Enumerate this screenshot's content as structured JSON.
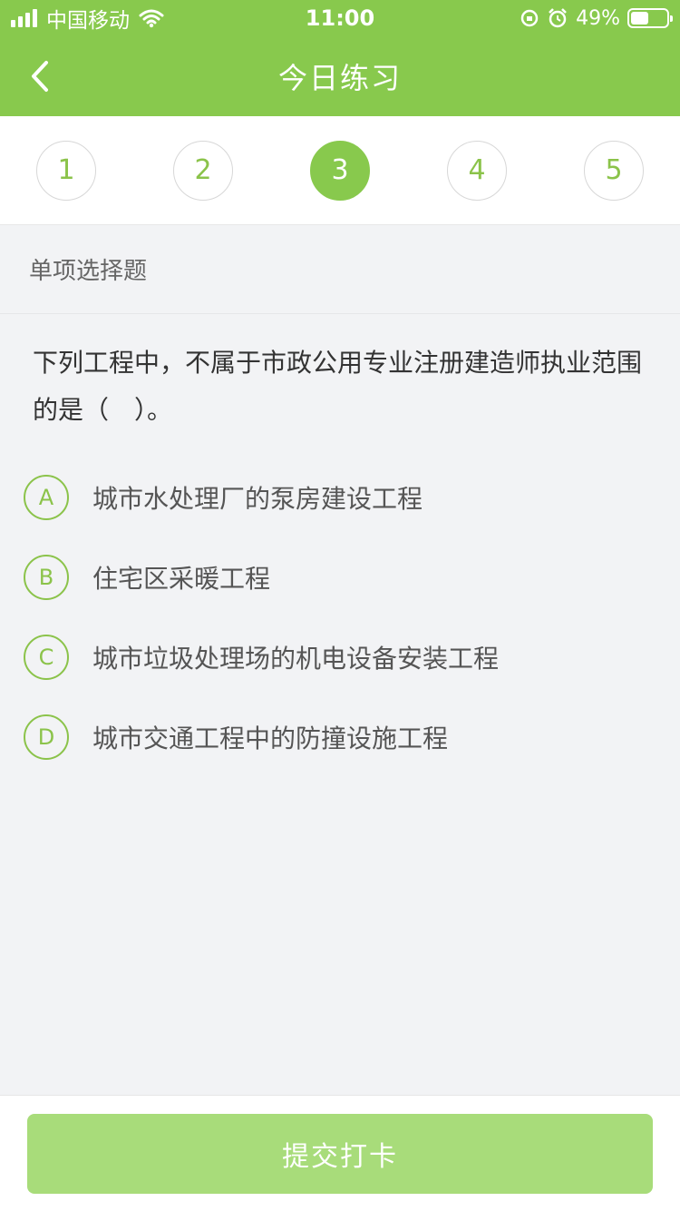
{
  "status_bar": {
    "carrier": "中国移动",
    "time": "11:00",
    "battery_text": "49%",
    "battery_level": 0.49
  },
  "nav": {
    "title": "今日练习",
    "back_icon": "chevron-left-icon"
  },
  "steps": [
    {
      "label": "1",
      "active": false
    },
    {
      "label": "2",
      "active": false
    },
    {
      "label": "3",
      "active": true
    },
    {
      "label": "4",
      "active": false
    },
    {
      "label": "5",
      "active": false
    }
  ],
  "question": {
    "type_label": "单项选择题",
    "text": "下列工程中，不属于市政公用专业注册建造师执业范围的是（　）。",
    "options": [
      {
        "letter": "A",
        "text": "城市水处理厂的泵房建设工程"
      },
      {
        "letter": "B",
        "text": "住宅区采暖工程"
      },
      {
        "letter": "C",
        "text": "城市垃圾处理场的机电设备安装工程"
      },
      {
        "letter": "D",
        "text": "城市交通工程中的防撞设施工程"
      }
    ]
  },
  "footer": {
    "submit_label": "提交打卡"
  },
  "colors": {
    "primary": "#88c94d",
    "submit_disabled": "#a8dc7a"
  }
}
